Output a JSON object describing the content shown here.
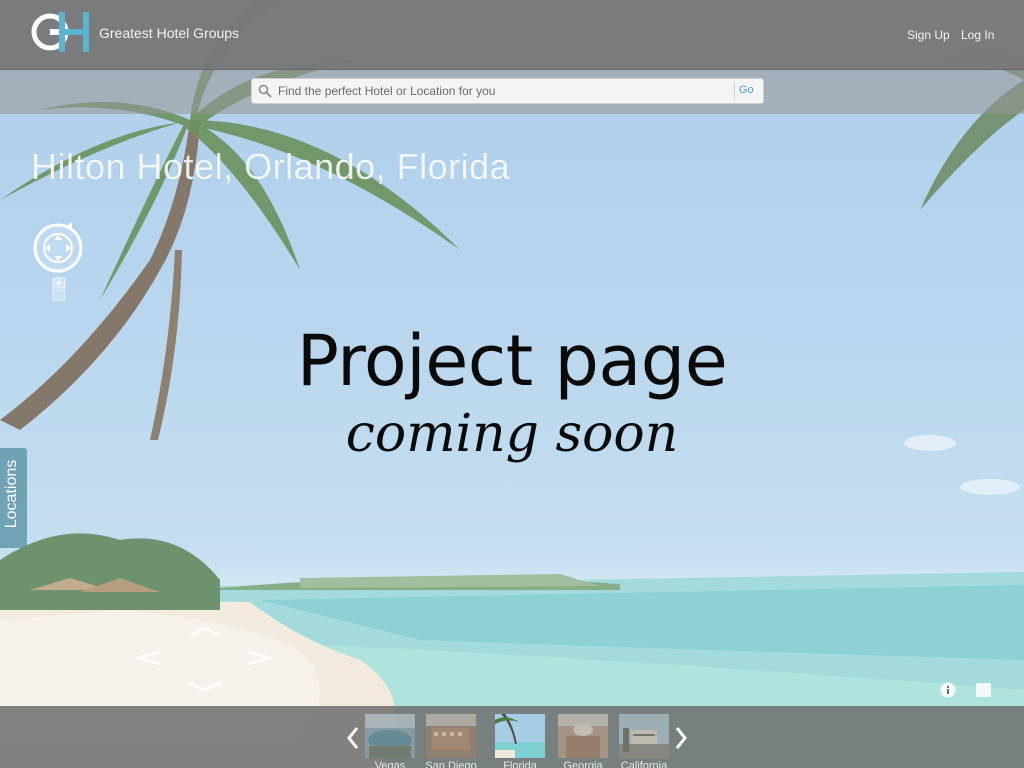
{
  "header": {
    "brand": "Greatest Hotel Groups",
    "logo_letters": "GH",
    "signup_label": "Sign Up",
    "login_label": "Log In"
  },
  "search": {
    "placeholder": "Find the perfect Hotel or Location for you",
    "go_label": "Go"
  },
  "hero": {
    "hotel_title": "Hilton Hotel, Orlando, Florida",
    "overlay_line1": "Project page",
    "overlay_line2": "coming soon",
    "locations_tab_label": "Locations"
  },
  "filmstrip": {
    "items": [
      {
        "label": "Vegas",
        "active": false
      },
      {
        "label": "San Diego",
        "active": false
      },
      {
        "label": "Florida",
        "active": true
      },
      {
        "label": "Georgia",
        "active": false
      },
      {
        "label": "California",
        "active": false
      }
    ]
  },
  "icons": {
    "search": "search-icon",
    "compass": "compass-icon",
    "zoom": "zoom-icon",
    "info": "info-icon",
    "fullscreen": "fullscreen-icon",
    "prev": "chevron-left-icon",
    "next": "chevron-right-icon"
  },
  "colors": {
    "accent": "#4fa3c6",
    "topbar": "#787878",
    "overlay_text": "#0a0a0a"
  }
}
